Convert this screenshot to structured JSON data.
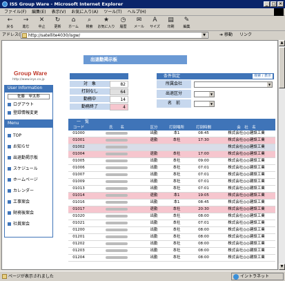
{
  "window": {
    "title": "ISS Group Ware - Microsoft Internet Explorer",
    "controls": [
      "_",
      "□",
      "×"
    ]
  },
  "menubar": [
    "ファイル(F)",
    "編集(E)",
    "表示(V)",
    "お気に入り(A)",
    "ツール(T)",
    "ヘルプ(H)"
  ],
  "toolbar": [
    {
      "label": "戻る",
      "icon": "back-arrow-icon",
      "glyph": "←"
    },
    {
      "label": "進む",
      "icon": "forward-arrow-icon",
      "glyph": "→"
    },
    {
      "label": "中止",
      "icon": "stop-icon",
      "glyph": "✕"
    },
    {
      "label": "更新",
      "icon": "refresh-icon",
      "glyph": "↻"
    },
    {
      "label": "ホーム",
      "icon": "home-icon",
      "glyph": "⌂"
    },
    {
      "label": "検索",
      "icon": "search-icon",
      "glyph": "⌕"
    },
    {
      "label": "お気に入り",
      "icon": "favorites-icon",
      "glyph": "★"
    },
    {
      "label": "履歴",
      "icon": "history-icon",
      "glyph": "◷"
    },
    {
      "label": "メール",
      "icon": "mail-icon",
      "glyph": "✉"
    },
    {
      "label": "サイズ",
      "icon": "font-size-icon",
      "glyph": "A"
    },
    {
      "label": "印刷",
      "icon": "print-icon",
      "glyph": "▤"
    },
    {
      "label": "編集",
      "icon": "edit-icon",
      "glyph": "✎"
    }
  ],
  "address": {
    "label": "アドレス(D)",
    "url": "http://satellite4030/isgw/",
    "go_label": "移動",
    "links_label": "リンク"
  },
  "sidebar": {
    "logo": "Group Ware",
    "logo_url": "http://www.isys.co.jp",
    "user_info_title": "User Information",
    "user_name": "佐藤　甲太郎",
    "user_items": [
      "ログアウト",
      "登録情報変更"
    ],
    "menu_title": "Menu",
    "menu_items": [
      "TOP",
      "お知らせ",
      "出退勤掲示板",
      "スケジュール",
      "ホームページ",
      "カレンダー",
      "工事案会",
      "財務後案会",
      "社員案会"
    ]
  },
  "main": {
    "page_title": "出退勤掲示板",
    "stats": [
      {
        "label": "対　象",
        "value": "82"
      },
      {
        "label": "打刻なし",
        "value": "64"
      },
      {
        "label": "勤務中",
        "value": "14"
      },
      {
        "label": "勤務終了",
        "value": "4"
      }
    ],
    "conditions": {
      "title": "条件指定",
      "button": "検索 / 表示",
      "fields": [
        {
          "label": "所属会社",
          "value": ""
        },
        {
          "label": "出退区分",
          "value": ""
        },
        {
          "label": "名　前",
          "value": ""
        }
      ]
    },
    "list_title": "一　覧",
    "columns": [
      "コード",
      "氏　　名",
      "区分",
      "打刻場所",
      "打刻時間",
      "会　社　名"
    ],
    "rows": [
      {
        "code": "01000",
        "status": "出勤",
        "place": "本1",
        "time": "08:45",
        "company": "株式会社◎◎建設工業",
        "style": "white"
      },
      {
        "code": "01001",
        "status": "退勤",
        "place": "本社",
        "time": "17:30",
        "company": "株式会社◎◎建設工業",
        "style": "pink"
      },
      {
        "code": "01002",
        "status": "",
        "place": "",
        "time": "",
        "company": "株式会社◎◎建設工業",
        "style": "grey"
      },
      {
        "code": "01004",
        "status": "退勤",
        "place": "本社",
        "time": "17:00",
        "company": "株式会社◎◎建設工業",
        "style": "pink"
      },
      {
        "code": "01005",
        "status": "出勤",
        "place": "本社",
        "time": "09:00",
        "company": "株式会社◎◎建設工業",
        "style": "white"
      },
      {
        "code": "01006",
        "status": "出勤",
        "place": "本社",
        "time": "07:01",
        "company": "株式会社◎◎建設工業",
        "style": "white"
      },
      {
        "code": "01007",
        "status": "出勤",
        "place": "本社",
        "time": "07:01",
        "company": "株式会社◎◎建設工業",
        "style": "white"
      },
      {
        "code": "01009",
        "status": "出勤",
        "place": "本社",
        "time": "07:01",
        "company": "株式会社◎◎建設工業",
        "style": "white"
      },
      {
        "code": "01013",
        "status": "出勤",
        "place": "本社",
        "time": "07:01",
        "company": "株式会社◎◎建設工業",
        "style": "white"
      },
      {
        "code": "01014",
        "status": "退勤",
        "place": "本1",
        "time": "19:05",
        "company": "株式会社◎◎建設工業",
        "style": "pink"
      },
      {
        "code": "01016",
        "status": "出勤",
        "place": "本1",
        "time": "08:45",
        "company": "株式会社◎◎建設工業",
        "style": "white"
      },
      {
        "code": "01017",
        "status": "退勤",
        "place": "本社",
        "time": "20:30",
        "company": "株式会社◎◎建設工業",
        "style": "pink"
      },
      {
        "code": "01020",
        "status": "出勤",
        "place": "本社",
        "time": "08:00",
        "company": "株式会社◎◎建設工業",
        "style": "white"
      },
      {
        "code": "01021",
        "status": "出勤",
        "place": "本社",
        "time": "07:01",
        "company": "株式会社◎◎建設工業",
        "style": "white"
      },
      {
        "code": "01200",
        "status": "出勤",
        "place": "本社",
        "time": "08:00",
        "company": "株式会社◎◎建設工業",
        "style": "white"
      },
      {
        "code": "01201",
        "status": "出勤",
        "place": "本社",
        "time": "08:00",
        "company": "株式会社◎◎建設工業",
        "style": "white"
      },
      {
        "code": "01202",
        "status": "出勤",
        "place": "本社",
        "time": "08:00",
        "company": "株式会社◎◎建設工業",
        "style": "white"
      },
      {
        "code": "01203",
        "status": "出勤",
        "place": "本社",
        "time": "08:00",
        "company": "株式会社◎◎建設工業",
        "style": "white"
      },
      {
        "code": "01204",
        "status": "出勤",
        "place": "本社",
        "time": "08:00",
        "company": "株式会社◎◎建設工業",
        "style": "white"
      }
    ]
  },
  "statusbar": {
    "text": "ページが表示されました",
    "zone": "イントラネット"
  }
}
